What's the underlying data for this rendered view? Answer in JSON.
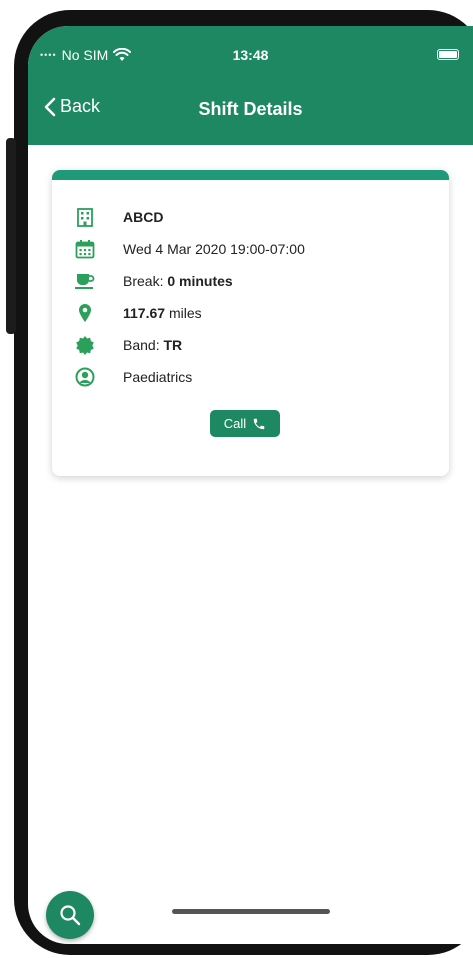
{
  "status_bar": {
    "carrier": "No SIM",
    "time": "13:48"
  },
  "nav": {
    "back_label": "Back",
    "title": "Shift Details"
  },
  "details": {
    "organisation": "ABCD",
    "datetime": "Wed 4 Mar 2020 19:00-07:00",
    "break_label": "Break:",
    "break_value": "0 minutes",
    "distance_value": "117.67",
    "distance_unit": "miles",
    "band_label": "Band:",
    "band_value": "TR",
    "department": "Paediatrics"
  },
  "call_button": {
    "label": "Call"
  },
  "colors": {
    "primary": "#1d8862",
    "accent": "#1f9a78",
    "icon": "#2aa05a"
  },
  "icons": [
    "wifi-icon",
    "battery-icon",
    "chevron-left-icon",
    "building-icon",
    "calendar-icon",
    "coffee-icon",
    "location-pin-icon",
    "badge-icon",
    "user-circle-icon",
    "phone-icon",
    "search-icon"
  ]
}
